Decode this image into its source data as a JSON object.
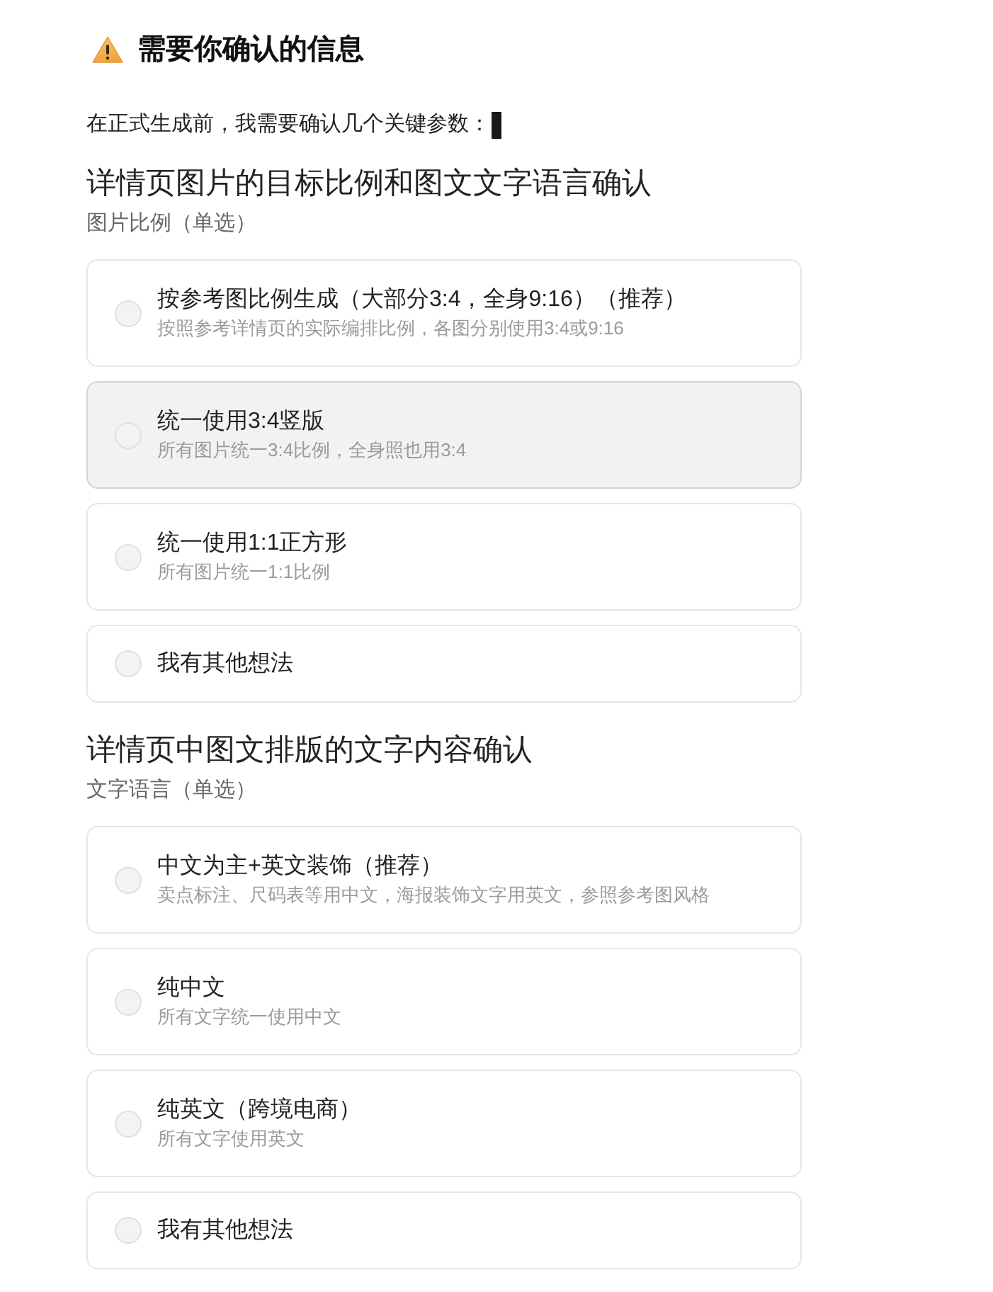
{
  "header": {
    "title": "需要你确认的信息"
  },
  "intro": {
    "text": "在正式生成前，我需要确认几个关键参数：",
    "cursor_visible": true
  },
  "sections": [
    {
      "title": "详情页图片的目标比例和图文文字语言确认",
      "subtitle": "图片比例（单选）",
      "options": [
        {
          "label": "按参考图比例生成（大部分3:4，全身9:16）（推荐）",
          "description": "按照参考详情页的实际编排比例，各图分别使用3:4或9:16",
          "selected": false,
          "hovered": false
        },
        {
          "label": "统一使用3:4竖版",
          "description": "所有图片统一3:4比例，全身照也用3:4",
          "selected": false,
          "hovered": true
        },
        {
          "label": "统一使用1:1正方形",
          "description": "所有图片统一1:1比例",
          "selected": false,
          "hovered": false
        },
        {
          "label": "我有其他想法",
          "selected": false,
          "hovered": false
        }
      ]
    },
    {
      "title": "详情页中图文排版的文字内容确认",
      "subtitle": "文字语言（单选）",
      "options": [
        {
          "label": "中文为主+英文装饰（推荐）",
          "description": "卖点标注、尺码表等用中文，海报装饰文字用英文，参照参考图风格",
          "selected": false,
          "hovered": false
        },
        {
          "label": "纯中文",
          "description": "所有文字统一使用中文",
          "selected": false,
          "hovered": false
        },
        {
          "label": "纯英文（跨境电商）",
          "description": "所有文字使用英文",
          "selected": false,
          "hovered": false
        },
        {
          "label": "我有其他想法",
          "selected": false,
          "hovered": false
        }
      ]
    }
  ]
}
